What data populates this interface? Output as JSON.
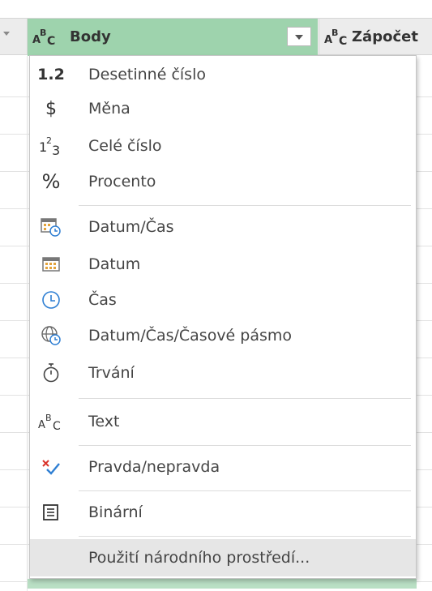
{
  "header": {
    "body_column": "Body",
    "next_column": "Zápočet"
  },
  "menu": {
    "items": [
      {
        "label": "Desetinné číslo",
        "icon": "decimal-number-icon",
        "glyph": "1.2"
      },
      {
        "label": "Měna",
        "icon": "currency-icon",
        "glyph": "$"
      },
      {
        "label": "Celé číslo",
        "icon": "whole-number-icon"
      },
      {
        "label": "Procento",
        "icon": "percent-icon",
        "glyph": "%"
      },
      {
        "label": "Datum/Čas",
        "icon": "datetime-icon"
      },
      {
        "label": "Datum",
        "icon": "date-icon"
      },
      {
        "label": "Čas",
        "icon": "time-icon"
      },
      {
        "label": "Datum/Čas/Časové pásmo",
        "icon": "datetime-timezone-icon"
      },
      {
        "label": "Trvání",
        "icon": "duration-icon"
      },
      {
        "label": "Text",
        "icon": "text-type-icon"
      },
      {
        "label": "Pravda/nepravda",
        "icon": "true-false-icon"
      },
      {
        "label": "Binární",
        "icon": "binary-icon"
      },
      {
        "label": "Použití národního prostředí...",
        "icon": "none"
      }
    ]
  },
  "colors": {
    "active_column": "#9ed3ad",
    "hover_item": "#e6e6e6"
  }
}
